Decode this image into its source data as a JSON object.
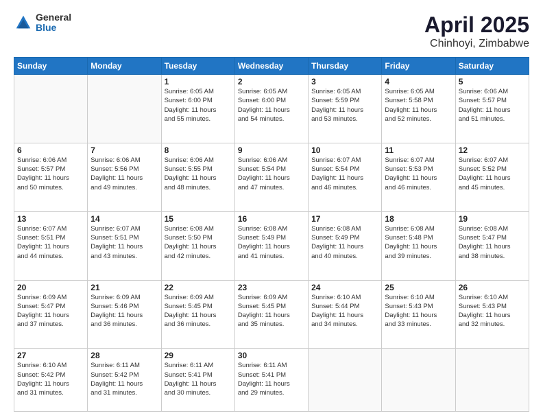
{
  "logo": {
    "general": "General",
    "blue": "Blue"
  },
  "title": "April 2025",
  "subtitle": "Chinhoyi, Zimbabwe",
  "days_of_week": [
    "Sunday",
    "Monday",
    "Tuesday",
    "Wednesday",
    "Thursday",
    "Friday",
    "Saturday"
  ],
  "weeks": [
    [
      {
        "day": "",
        "info": ""
      },
      {
        "day": "",
        "info": ""
      },
      {
        "day": "1",
        "info": "Sunrise: 6:05 AM\nSunset: 6:00 PM\nDaylight: 11 hours\nand 55 minutes."
      },
      {
        "day": "2",
        "info": "Sunrise: 6:05 AM\nSunset: 6:00 PM\nDaylight: 11 hours\nand 54 minutes."
      },
      {
        "day": "3",
        "info": "Sunrise: 6:05 AM\nSunset: 5:59 PM\nDaylight: 11 hours\nand 53 minutes."
      },
      {
        "day": "4",
        "info": "Sunrise: 6:05 AM\nSunset: 5:58 PM\nDaylight: 11 hours\nand 52 minutes."
      },
      {
        "day": "5",
        "info": "Sunrise: 6:06 AM\nSunset: 5:57 PM\nDaylight: 11 hours\nand 51 minutes."
      }
    ],
    [
      {
        "day": "6",
        "info": "Sunrise: 6:06 AM\nSunset: 5:57 PM\nDaylight: 11 hours\nand 50 minutes."
      },
      {
        "day": "7",
        "info": "Sunrise: 6:06 AM\nSunset: 5:56 PM\nDaylight: 11 hours\nand 49 minutes."
      },
      {
        "day": "8",
        "info": "Sunrise: 6:06 AM\nSunset: 5:55 PM\nDaylight: 11 hours\nand 48 minutes."
      },
      {
        "day": "9",
        "info": "Sunrise: 6:06 AM\nSunset: 5:54 PM\nDaylight: 11 hours\nand 47 minutes."
      },
      {
        "day": "10",
        "info": "Sunrise: 6:07 AM\nSunset: 5:54 PM\nDaylight: 11 hours\nand 46 minutes."
      },
      {
        "day": "11",
        "info": "Sunrise: 6:07 AM\nSunset: 5:53 PM\nDaylight: 11 hours\nand 46 minutes."
      },
      {
        "day": "12",
        "info": "Sunrise: 6:07 AM\nSunset: 5:52 PM\nDaylight: 11 hours\nand 45 minutes."
      }
    ],
    [
      {
        "day": "13",
        "info": "Sunrise: 6:07 AM\nSunset: 5:51 PM\nDaylight: 11 hours\nand 44 minutes."
      },
      {
        "day": "14",
        "info": "Sunrise: 6:07 AM\nSunset: 5:51 PM\nDaylight: 11 hours\nand 43 minutes."
      },
      {
        "day": "15",
        "info": "Sunrise: 6:08 AM\nSunset: 5:50 PM\nDaylight: 11 hours\nand 42 minutes."
      },
      {
        "day": "16",
        "info": "Sunrise: 6:08 AM\nSunset: 5:49 PM\nDaylight: 11 hours\nand 41 minutes."
      },
      {
        "day": "17",
        "info": "Sunrise: 6:08 AM\nSunset: 5:49 PM\nDaylight: 11 hours\nand 40 minutes."
      },
      {
        "day": "18",
        "info": "Sunrise: 6:08 AM\nSunset: 5:48 PM\nDaylight: 11 hours\nand 39 minutes."
      },
      {
        "day": "19",
        "info": "Sunrise: 6:08 AM\nSunset: 5:47 PM\nDaylight: 11 hours\nand 38 minutes."
      }
    ],
    [
      {
        "day": "20",
        "info": "Sunrise: 6:09 AM\nSunset: 5:47 PM\nDaylight: 11 hours\nand 37 minutes."
      },
      {
        "day": "21",
        "info": "Sunrise: 6:09 AM\nSunset: 5:46 PM\nDaylight: 11 hours\nand 36 minutes."
      },
      {
        "day": "22",
        "info": "Sunrise: 6:09 AM\nSunset: 5:45 PM\nDaylight: 11 hours\nand 36 minutes."
      },
      {
        "day": "23",
        "info": "Sunrise: 6:09 AM\nSunset: 5:45 PM\nDaylight: 11 hours\nand 35 minutes."
      },
      {
        "day": "24",
        "info": "Sunrise: 6:10 AM\nSunset: 5:44 PM\nDaylight: 11 hours\nand 34 minutes."
      },
      {
        "day": "25",
        "info": "Sunrise: 6:10 AM\nSunset: 5:43 PM\nDaylight: 11 hours\nand 33 minutes."
      },
      {
        "day": "26",
        "info": "Sunrise: 6:10 AM\nSunset: 5:43 PM\nDaylight: 11 hours\nand 32 minutes."
      }
    ],
    [
      {
        "day": "27",
        "info": "Sunrise: 6:10 AM\nSunset: 5:42 PM\nDaylight: 11 hours\nand 31 minutes."
      },
      {
        "day": "28",
        "info": "Sunrise: 6:11 AM\nSunset: 5:42 PM\nDaylight: 11 hours\nand 31 minutes."
      },
      {
        "day": "29",
        "info": "Sunrise: 6:11 AM\nSunset: 5:41 PM\nDaylight: 11 hours\nand 30 minutes."
      },
      {
        "day": "30",
        "info": "Sunrise: 6:11 AM\nSunset: 5:41 PM\nDaylight: 11 hours\nand 29 minutes."
      },
      {
        "day": "",
        "info": ""
      },
      {
        "day": "",
        "info": ""
      },
      {
        "day": "",
        "info": ""
      }
    ]
  ]
}
